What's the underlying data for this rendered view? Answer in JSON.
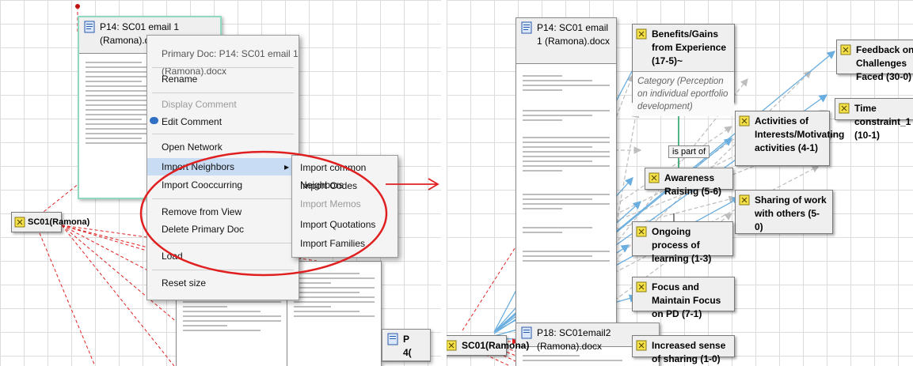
{
  "left": {
    "doc_card": {
      "title": "P14: SC01 email 1 (Ramona).docx"
    },
    "context_menu": {
      "header": "Primary Doc: P14: SC01 email 1 (Ramona).docx",
      "items": [
        {
          "label": "Rename",
          "disabled": false
        },
        {
          "label": "Display Comment",
          "disabled": true
        },
        {
          "label": "Edit Comment",
          "disabled": false
        },
        {
          "label": "Open Network",
          "disabled": false
        },
        {
          "label": "Import Neighbors",
          "disabled": false,
          "submenu": true
        },
        {
          "label": "Import Cooccurring",
          "disabled": false
        },
        {
          "label": "Remove from View",
          "disabled": false
        },
        {
          "label": "Delete Primary Doc",
          "disabled": false
        },
        {
          "label": "Load",
          "disabled": false
        },
        {
          "label": "Reset size",
          "disabled": false
        }
      ],
      "submenu_arrow": "▸"
    },
    "submenu": {
      "items": [
        {
          "label": "Import common Neighbors",
          "disabled": false
        },
        {
          "label": "Import Codes",
          "disabled": false
        },
        {
          "label": "Import Memos",
          "disabled": true
        },
        {
          "label": "Import Quotations",
          "disabled": false
        },
        {
          "label": "Import Families",
          "disabled": false
        }
      ]
    },
    "sc01_node": "SC01(Ramona)",
    "partial_label": "P",
    "partial_label2": "4("
  },
  "right": {
    "doc_p14": "P14: SC01 email 1 (Ramona).docx",
    "doc_p18": "P18: SC01email2 (Ramona).docx",
    "sc01_node": "SC01(Ramona)",
    "is_part_of": "is part of",
    "codes": {
      "benefits": "Benefits/Gains from Experience (17-5)~",
      "benefits_comment": "Category (Perception on individual eportfolio development)",
      "feedback": "Feedback on Challenges Faced (30-0)",
      "time": "Time constraint_1 (10-1)",
      "activities": "Activities of Interests/Motivating activities (4-1)",
      "awareness": "Awareness Raising (5-6)",
      "sharing": "Sharing of work with others (5-0)",
      "ongoing": "Ongoing process of learning (1-3)",
      "focus": "Focus and Maintain Focus on PD (7-1)",
      "increased": "Increased sense of sharing (1-0)"
    }
  },
  "colors": {
    "highlight_ellipse": "#e02020",
    "arrow_red": "#e02020",
    "edge_blue": "#6aaee0",
    "edge_gray": "#bdbdbd",
    "edge_green": "#1a9a60"
  },
  "icons": {
    "code": "code-star-icon",
    "document": "document-icon",
    "transition": "red-arrow-icon"
  }
}
